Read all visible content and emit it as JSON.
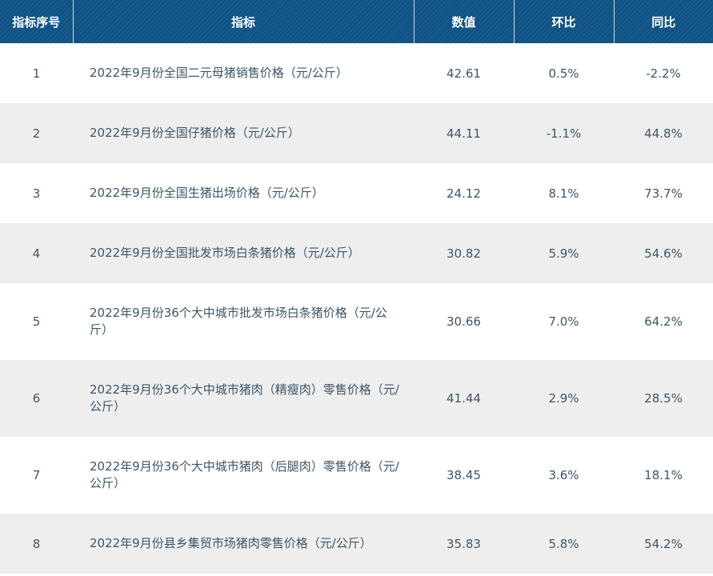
{
  "headers": [
    "指标序号",
    "指标",
    "数值",
    "环比",
    "同比"
  ],
  "rows": [
    {
      "index": "1",
      "name": "2022年9月份全国二元母猪销售价格（元/公斤）",
      "value": "42.61",
      "mom": "0.5%",
      "yoy": "-2.2%"
    },
    {
      "index": "2",
      "name": "2022年9月份全国仔猪价格（元/公斤）",
      "value": "44.11",
      "mom": "-1.1%",
      "yoy": "44.8%"
    },
    {
      "index": "3",
      "name": "2022年9月份全国生猪出场价格（元/公斤）",
      "value": "24.12",
      "mom": "8.1%",
      "yoy": "73.7%"
    },
    {
      "index": "4",
      "name": "2022年9月份全国批发市场白条猪价格（元/公斤）",
      "value": "30.82",
      "mom": "5.9%",
      "yoy": "54.6%"
    },
    {
      "index": "5",
      "name": "2022年9月份36个大中城市批发市场白条猪价格（元/公斤）",
      "value": "30.66",
      "mom": "7.0%",
      "yoy": "64.2%"
    },
    {
      "index": "6",
      "name": "2022年9月份36个大中城市猪肉（精瘦肉）零售价格（元/公斤）",
      "value": "41.44",
      "mom": "2.9%",
      "yoy": "28.5%"
    },
    {
      "index": "7",
      "name": "2022年9月份36个大中城市猪肉（后腿肉）零售价格（元/公斤）",
      "value": "38.45",
      "mom": "3.6%",
      "yoy": "18.1%"
    },
    {
      "index": "8",
      "name": "2022年9月份县乡集贸市场猪肉零售价格（元/公斤）",
      "value": "35.83",
      "mom": "5.8%",
      "yoy": "54.2%"
    }
  ]
}
